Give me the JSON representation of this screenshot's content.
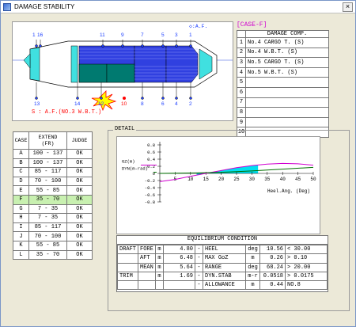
{
  "window": {
    "title": "DAMAGE STABILITY",
    "close_symbol": "×"
  },
  "ship": {
    "top_labels": [
      "1",
      "16",
      "11",
      "9",
      "7",
      "5",
      "3",
      "1"
    ],
    "mid_label": "◇:A.F.",
    "bottom_labels": [
      "13",
      "14",
      "12",
      "10",
      "8",
      "6",
      "4",
      "2"
    ],
    "caption": "S : A.F.(NO.3 W.B.T.)"
  },
  "case_table": {
    "headers": [
      "CASE",
      "EXTEND\n(FR)",
      "JUDGE"
    ],
    "rows": [
      [
        "A",
        "100 - 137",
        "OK"
      ],
      [
        "B",
        "100 - 137",
        "OK"
      ],
      [
        "C",
        "85 - 117",
        "OK"
      ],
      [
        "D",
        "70 - 100",
        "OK"
      ],
      [
        "E",
        "55 - 85",
        "OK"
      ],
      [
        "F",
        "35 - 70",
        "OK"
      ],
      [
        "G",
        "7 - 35",
        "OK"
      ],
      [
        "H",
        "7 - 35",
        "OK"
      ],
      [
        "I",
        "85 - 117",
        "OK"
      ],
      [
        "J",
        "70 - 100",
        "OK"
      ],
      [
        "K",
        "55 - 85",
        "OK"
      ],
      [
        "L",
        "35 - 70",
        "OK"
      ]
    ],
    "selected_index": 5
  },
  "case_title": "[CASE-F]",
  "damage_comp": {
    "header": "DAMAGE COMP.",
    "rows": [
      "No.4 CARGO T. (S)",
      "No.4 W.B.T. (S)",
      "No.5 CARGO T. (S)",
      "No.5 W.B.T. (S)",
      "",
      "",
      "",
      "",
      "",
      ""
    ],
    "numbers": [
      "1",
      "2",
      "3",
      "4",
      "5",
      "6",
      "7",
      "8",
      "9",
      "10"
    ]
  },
  "detail": {
    "title": "DETAIL",
    "chart_data": {
      "type": "line",
      "x_ticks": [
        "5",
        "10",
        "15",
        "20",
        "25",
        "30",
        "35",
        "40",
        "45",
        "50"
      ],
      "y_ticks": [
        "0.8",
        "0.6",
        "0.4",
        "0.2",
        "0",
        "-0.2",
        "-0.4",
        "-0.6",
        "-0.8"
      ],
      "xlabel": "Heel.Ang. (Deg)",
      "xlim": [
        0,
        50
      ],
      "ylim": [
        -0.8,
        0.8
      ],
      "series": [
        {
          "name": "GZ(m)",
          "color": "#d000d0",
          "x": [
            0,
            5,
            10,
            15,
            20,
            25,
            30,
            35,
            40,
            45,
            50
          ],
          "y": [
            -0.23,
            -0.17,
            -0.08,
            0.0,
            0.08,
            0.16,
            0.22,
            0.26,
            0.28,
            0.27,
            0.23
          ]
        },
        {
          "name": "DYN(m-rad)",
          "color": "#007000",
          "x": [
            0,
            10,
            20,
            30,
            40,
            50
          ],
          "y": [
            0.0,
            0.01,
            0.03,
            0.07,
            0.12,
            0.17
          ]
        }
      ],
      "shaded_range": [
        12,
        32
      ],
      "shade_color": "#00e0f0"
    },
    "equilibrium": {
      "title": "EQUILIBRIUM CONDITION",
      "rows": [
        [
          "DRAFT",
          "FORE",
          "m",
          "4.80",
          "-",
          "HEEL",
          "deg",
          "10.56",
          "< 30.00"
        ],
        [
          "",
          "AFT",
          "m",
          "6.48",
          "-",
          "MAX GoZ",
          "m",
          "0.26",
          "> 0.10"
        ],
        [
          "",
          "MEAN",
          "m",
          "5.64",
          "-",
          "RANGE",
          "deg",
          "68.24",
          "> 20.00"
        ],
        [
          "TRIM",
          "",
          "m",
          "1.69",
          "-",
          "DYN.STAB",
          "m-r",
          "0.0518",
          "> 0.0175"
        ],
        [
          "",
          "",
          "",
          "",
          "-",
          "ALLOWANCE",
          "m",
          "0.44",
          "NO.8"
        ]
      ]
    }
  }
}
